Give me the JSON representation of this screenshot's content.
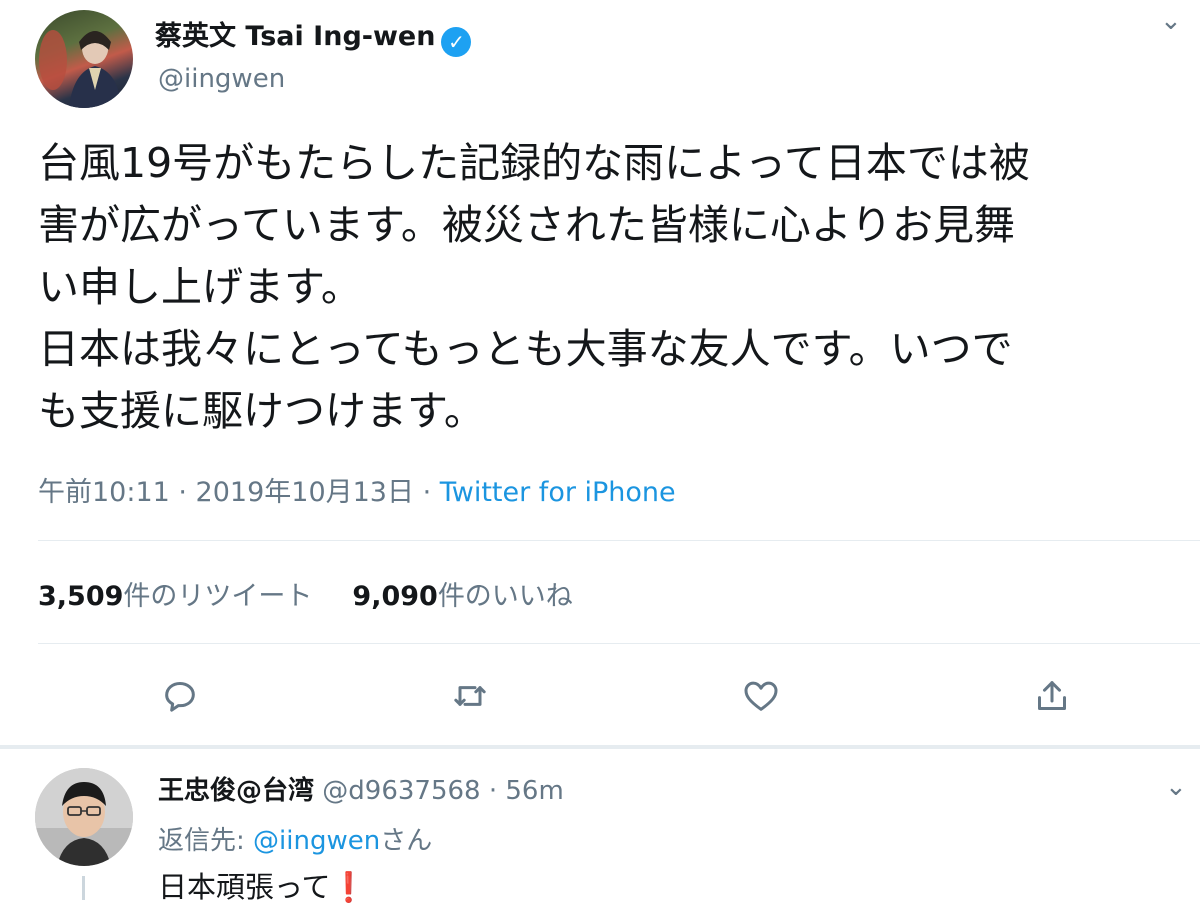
{
  "tweet": {
    "author_name": "蔡英文 Tsai Ing-wen",
    "verified_mark": "✓",
    "handle": "@iingwen",
    "caret": "⌄",
    "text": "台風19号がもたらした記録的な雨によって日本では被\n害が広がっています。被災された皆様に心よりお見舞\nい申し上げます。\n日本は我々にとってもっとも大事な友人です。いつで\nも支援に駆けつけます。",
    "time": "午前10:11 · 2019年10月13日 · ",
    "source": "Twitter for iPhone",
    "retweet_count": "3,509",
    "retweet_label": "件のリツイート",
    "like_count": "9,090",
    "like_label": "件のいいね",
    "actions": [
      "reply-icon",
      "retweet-icon",
      "like-icon",
      "share-icon"
    ]
  },
  "reply": {
    "author_name": "王忠俊@台湾",
    "handle": "@d9637568",
    "time": "· 56m",
    "caret": "⌄",
    "replying_label": "返信先: ",
    "replying_mention": "@iingwen",
    "replying_suffix": "さん",
    "text": "日本頑張って❗"
  },
  "colors": {
    "accent": "#1da1f2",
    "link": "#1b95e0",
    "secondary_text": "#657786",
    "divider": "#e6ecf0"
  }
}
